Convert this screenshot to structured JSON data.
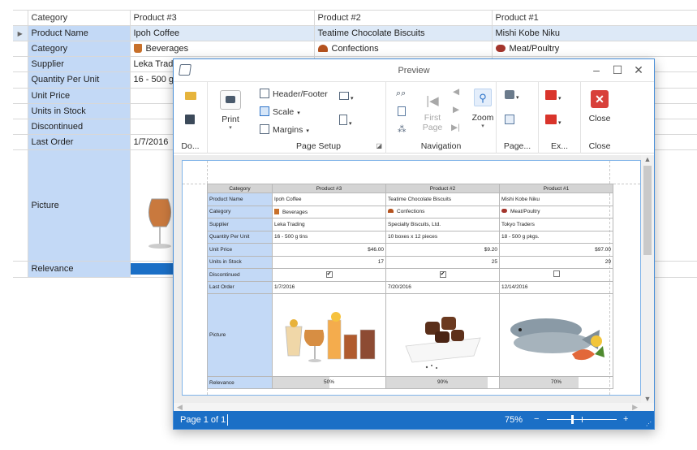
{
  "grid": {
    "columns": [
      "Category",
      "Product #3",
      "Product #2",
      "Product #1"
    ],
    "rows": {
      "product_name": {
        "label": "Product Name",
        "v3": "Ipoh Coffee",
        "v2": "Teatime Chocolate Biscuits",
        "v1": "Mishi Kobe Niku"
      },
      "category": {
        "label": "Category",
        "v3": "Beverages",
        "v2": "Confections",
        "v1": "Meat/Poultry"
      },
      "supplier": {
        "label": "Supplier",
        "v3": "Leka Trading"
      },
      "qpu": {
        "label": "Quantity Per Unit",
        "v3": "16 - 500 g tins"
      },
      "unit_price": {
        "label": "Unit Price"
      },
      "units_stock": {
        "label": "Units in Stock"
      },
      "discontinued": {
        "label": "Discontinued"
      },
      "last_order": {
        "label": "Last Order",
        "v3": "1/7/2016"
      },
      "picture": {
        "label": "Picture"
      },
      "relevance": {
        "label": "Relevance"
      }
    }
  },
  "preview": {
    "title": "Preview",
    "ribbon": {
      "document_group": "Do...",
      "print": "Print",
      "header_footer": "Header/Footer",
      "scale": "Scale",
      "margins": "Margins",
      "page_setup_group": "Page Setup",
      "first_page_1": "First",
      "first_page_2": "Page",
      "zoom": "Zoom",
      "navigation_group": "Navigation",
      "page_bg_group": "Page...",
      "export_group": "Ex...",
      "close": "Close",
      "close_group": "Close"
    },
    "status": {
      "page": "Page 1 of 1",
      "zoom": "75%",
      "minus": "−",
      "plus": "+"
    },
    "doc": {
      "headers": [
        "Category",
        "Product #3",
        "Product #2",
        "Product #1"
      ],
      "rows": {
        "product_name": {
          "label": "Product Name",
          "v3": "Ipoh Coffee",
          "v2": "Teatime Chocolate Biscuits",
          "v1": "Mishi Kobe Niku"
        },
        "category": {
          "label": "Category",
          "v3": "Beverages",
          "v2": "Confections",
          "v1": "Meat/Poultry"
        },
        "supplier": {
          "label": "Supplier",
          "v3": "Leka Trading",
          "v2": "Specialty Biscuits, Ltd.",
          "v1": "Tokyo Traders"
        },
        "qpu": {
          "label": "Quantity Per Unit",
          "v3": "16 - 500 g tins",
          "v2": "10 boxes x 12 pieces",
          "v1": "18 - 500 g pkgs."
        },
        "unit_price": {
          "label": "Unit Price",
          "v3": "$46.00",
          "v2": "$9.20",
          "v1": "$97.00"
        },
        "units_stock": {
          "label": "Units in Stock",
          "v3": "17",
          "v2": "25",
          "v1": "29"
        },
        "discontinued": {
          "label": "Discontinued",
          "v3": "✔",
          "v2": "✔",
          "v1": ""
        },
        "last_order": {
          "label": "Last Order",
          "v3": "1/7/2016",
          "v2": "7/20/2016",
          "v1": "12/14/2016"
        },
        "picture": {
          "label": "Picture"
        },
        "relevance": {
          "label": "Relevance",
          "v3": "50%",
          "v2": "90%",
          "v1": "70%"
        }
      },
      "relevance_values": [
        0.5,
        0.9,
        0.7
      ]
    }
  },
  "colors": {
    "accent": "#1b6fc6",
    "header_cell": "#c3d9f6"
  }
}
